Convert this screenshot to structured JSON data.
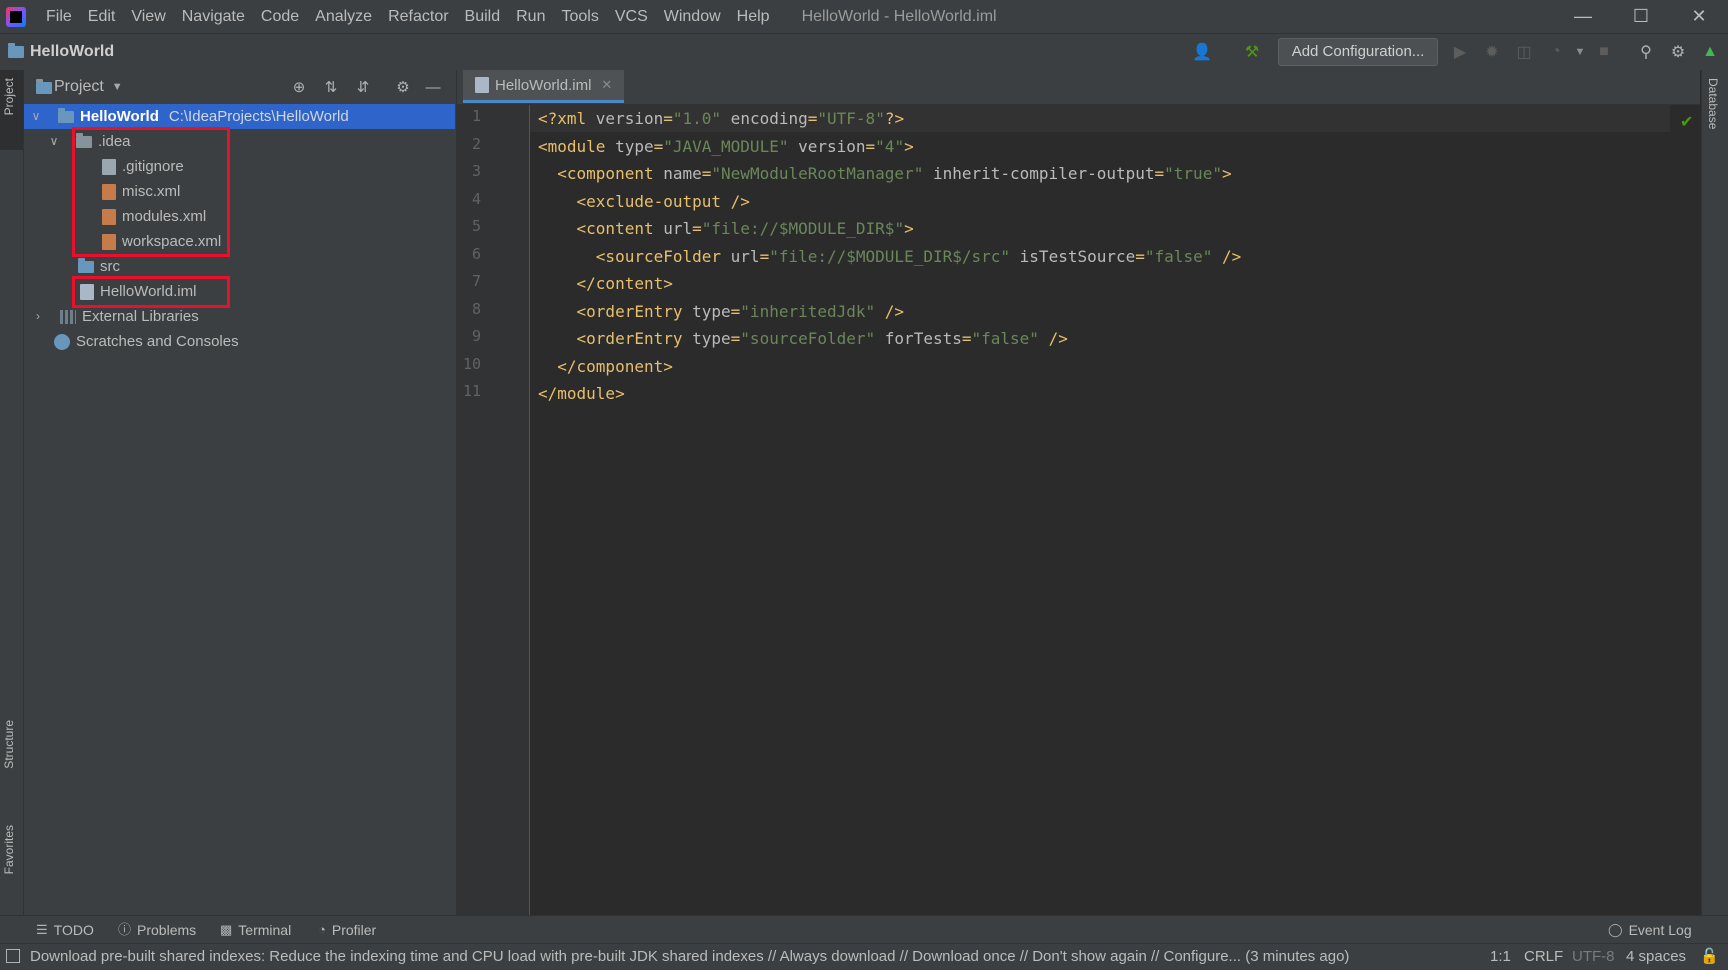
{
  "window": {
    "title": "HelloWorld - HelloWorld.iml",
    "menu": [
      "File",
      "Edit",
      "View",
      "Navigate",
      "Code",
      "Analyze",
      "Refactor",
      "Build",
      "Run",
      "Tools",
      "VCS",
      "Window",
      "Help"
    ],
    "controls": [
      "minimize-icon",
      "maximize-icon",
      "close-icon"
    ]
  },
  "navbar": {
    "project_name": "HelloWorld",
    "add_configuration": "Add Configuration..."
  },
  "side_tabs": {
    "left_top": "Project",
    "left_structure": "Structure",
    "left_favorites": "Favorites",
    "right_database": "Database"
  },
  "project_panel": {
    "title": "Project",
    "tree": {
      "root": {
        "label": "HelloWorld",
        "path": "C:\\IdeaProjects\\HelloWorld"
      },
      "idea_folder": ".idea",
      "gitignore": ".gitignore",
      "misc": "misc.xml",
      "modules": "modules.xml",
      "workspace": "workspace.xml",
      "src": "src",
      "iml": "HelloWorld.iml",
      "external_libraries": "External Libraries",
      "scratches": "Scratches and Consoles"
    },
    "highlight_color": "#e8102a"
  },
  "editor": {
    "tab_label": "HelloWorld.iml",
    "line_numbers": [
      "1",
      "2",
      "3",
      "4",
      "5",
      "6",
      "7",
      "8",
      "9",
      "10",
      "11"
    ],
    "lines": [
      [
        [
          "pi",
          "<?xml "
        ],
        [
          "attr",
          "version"
        ],
        [
          "punc",
          "="
        ],
        [
          "val",
          "\"1.0\""
        ],
        [
          "attr",
          " encoding"
        ],
        [
          "punc",
          "="
        ],
        [
          "val",
          "\"UTF-8\""
        ],
        [
          "pi",
          "?>"
        ]
      ],
      [
        [
          "tag",
          "<module "
        ],
        [
          "attr",
          "type"
        ],
        [
          "punc",
          "="
        ],
        [
          "val",
          "\"JAVA_MODULE\""
        ],
        [
          "attr",
          " version"
        ],
        [
          "punc",
          "="
        ],
        [
          "val",
          "\"4\""
        ],
        [
          "tag",
          ">"
        ]
      ],
      [
        [
          "tag",
          "  <component "
        ],
        [
          "attr",
          "name"
        ],
        [
          "punc",
          "="
        ],
        [
          "val",
          "\"NewModuleRootManager\""
        ],
        [
          "attr",
          " inherit-compiler-output"
        ],
        [
          "punc",
          "="
        ],
        [
          "val",
          "\"true\""
        ],
        [
          "tag",
          ">"
        ]
      ],
      [
        [
          "tag",
          "    <exclude-output />"
        ]
      ],
      [
        [
          "tag",
          "    <content "
        ],
        [
          "attr",
          "url"
        ],
        [
          "punc",
          "="
        ],
        [
          "val",
          "\"file://$MODULE_DIR$\""
        ],
        [
          "tag",
          ">"
        ]
      ],
      [
        [
          "tag",
          "      <sourceFolder "
        ],
        [
          "attr",
          "url"
        ],
        [
          "punc",
          "="
        ],
        [
          "val",
          "\"file://$MODULE_DIR$/src\""
        ],
        [
          "attr",
          " isTestSource"
        ],
        [
          "punc",
          "="
        ],
        [
          "val",
          "\"false\""
        ],
        [
          "tag",
          " />"
        ]
      ],
      [
        [
          "tag",
          "    </content>"
        ]
      ],
      [
        [
          "tag",
          "    <orderEntry "
        ],
        [
          "attr",
          "type"
        ],
        [
          "punc",
          "="
        ],
        [
          "val",
          "\"inheritedJdk\""
        ],
        [
          "tag",
          " />"
        ]
      ],
      [
        [
          "tag",
          "    <orderEntry "
        ],
        [
          "attr",
          "type"
        ],
        [
          "punc",
          "="
        ],
        [
          "val",
          "\"sourceFolder\""
        ],
        [
          "attr",
          " forTests"
        ],
        [
          "punc",
          "="
        ],
        [
          "val",
          "\"false\""
        ],
        [
          "tag",
          " />"
        ]
      ],
      [
        [
          "tag",
          "  </component>"
        ]
      ],
      [
        [
          "tag",
          "</module>"
        ]
      ]
    ]
  },
  "bottom_tools": {
    "todo": "TODO",
    "problems": "Problems",
    "terminal": "Terminal",
    "profiler": "Profiler",
    "event_log": "Event Log"
  },
  "status": {
    "message": "Download pre-built shared indexes: Reduce the indexing time and CPU load with pre-built JDK shared indexes // Always download // Download once // Don't show again // Configure... (3 minutes ago)",
    "position": "1:1",
    "line_sep": "CRLF",
    "encoding": "UTF-8",
    "indent": "4 spaces"
  }
}
